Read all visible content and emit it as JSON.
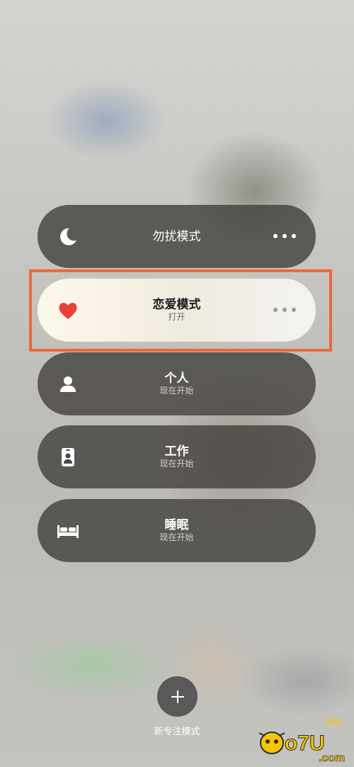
{
  "focus_modes": [
    {
      "title": "勿扰模式",
      "subtitle": "",
      "icon": "moon-icon",
      "active": false
    },
    {
      "title": "恋爱模式",
      "subtitle": "打开",
      "icon": "heart-icon",
      "active": true,
      "icon_color": "#e5413a"
    },
    {
      "title": "个人",
      "subtitle": "现在开始",
      "icon": "person-icon",
      "active": false
    },
    {
      "title": "工作",
      "subtitle": "现在开始",
      "icon": "id-badge-icon",
      "active": false
    },
    {
      "title": "睡眠",
      "subtitle": "现在开始",
      "icon": "bed-icon",
      "active": false
    }
  ],
  "new_focus": {
    "label": "新专注模式",
    "icon": "plus-icon"
  },
  "colors": {
    "highlight_border": "#e86a3c",
    "active_pill": "#f5f0e2",
    "inactive_pill": "#444240"
  },
  "watermark": {
    "text": "oo7U.com",
    "badge": "游戏"
  }
}
